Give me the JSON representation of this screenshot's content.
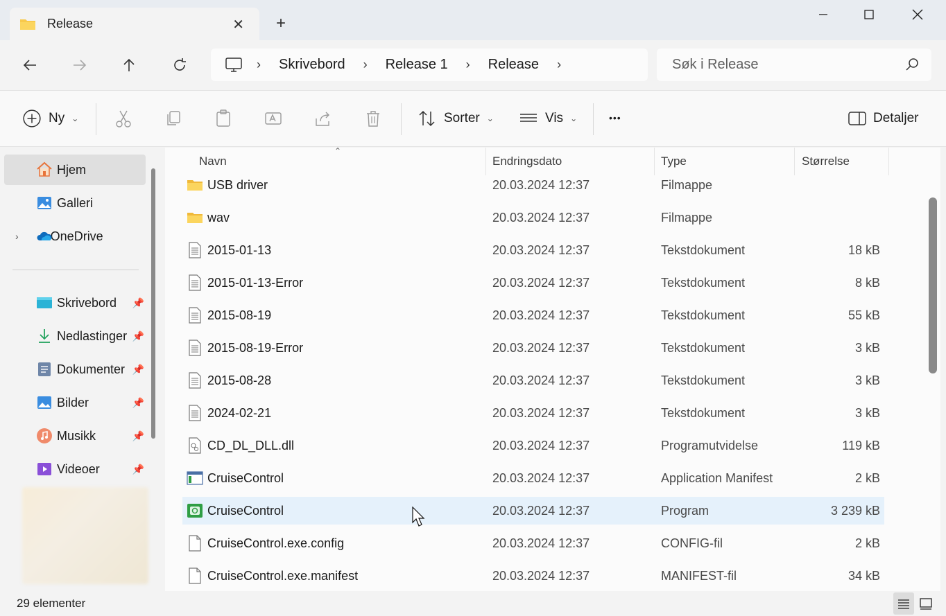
{
  "window": {
    "tab_title": "Release",
    "tab_icon": "folder-icon",
    "new_tab_label": "+",
    "close_tab_label": "✕"
  },
  "address": {
    "crumbs": [
      "Skrivebord",
      "Release 1",
      "Release"
    ],
    "root_icon": "computer-icon"
  },
  "search": {
    "placeholder": "Søk i Release"
  },
  "toolbar": {
    "new_label": "Ny",
    "sort_label": "Sorter",
    "view_label": "Vis",
    "more_label": "•••",
    "details_label": "Detaljer"
  },
  "sidebar": {
    "items": [
      {
        "label": "Hjem",
        "icon": "home-icon"
      },
      {
        "label": "Galleri",
        "icon": "gallery-icon"
      },
      {
        "label": "OneDrive",
        "icon": "onedrive-icon"
      },
      {
        "label": "Skrivebord",
        "icon": "desktop-icon"
      },
      {
        "label": "Nedlastinger",
        "icon": "download-icon"
      },
      {
        "label": "Dokumenter",
        "icon": "document-icon"
      },
      {
        "label": "Bilder",
        "icon": "pictures-icon"
      },
      {
        "label": "Musikk",
        "icon": "music-icon"
      },
      {
        "label": "Videoer",
        "icon": "video-icon"
      }
    ]
  },
  "columns": {
    "name": "Navn",
    "date": "Endringsdato",
    "type": "Type",
    "size": "Størrelse"
  },
  "files": [
    {
      "name": "USB driver",
      "date": "20.03.2024 12:37",
      "type": "Filmappe",
      "size": "",
      "icon": "folder-icon"
    },
    {
      "name": "wav",
      "date": "20.03.2024 12:37",
      "type": "Filmappe",
      "size": "",
      "icon": "folder-icon"
    },
    {
      "name": "2015-01-13",
      "date": "20.03.2024 12:37",
      "type": "Tekstdokument",
      "size": "18 kB",
      "icon": "text-file-icon"
    },
    {
      "name": "2015-01-13-Error",
      "date": "20.03.2024 12:37",
      "type": "Tekstdokument",
      "size": "8 kB",
      "icon": "text-file-icon"
    },
    {
      "name": "2015-08-19",
      "date": "20.03.2024 12:37",
      "type": "Tekstdokument",
      "size": "55 kB",
      "icon": "text-file-icon"
    },
    {
      "name": "2015-08-19-Error",
      "date": "20.03.2024 12:37",
      "type": "Tekstdokument",
      "size": "3 kB",
      "icon": "text-file-icon"
    },
    {
      "name": "2015-08-28",
      "date": "20.03.2024 12:37",
      "type": "Tekstdokument",
      "size": "3 kB",
      "icon": "text-file-icon"
    },
    {
      "name": "2024-02-21",
      "date": "20.03.2024 12:37",
      "type": "Tekstdokument",
      "size": "3 kB",
      "icon": "text-file-icon"
    },
    {
      "name": "CD_DL_DLL.dll",
      "date": "20.03.2024 12:37",
      "type": "Programutvidelse",
      "size": "119 kB",
      "icon": "dll-file-icon"
    },
    {
      "name": "CruiseControl",
      "date": "20.03.2024 12:37",
      "type": "Application Manifest",
      "size": "2 kB",
      "icon": "manifest-file-icon"
    },
    {
      "name": "CruiseControl",
      "date": "20.03.2024 12:37",
      "type": "Program",
      "size": "3 239 kB",
      "icon": "program-icon"
    },
    {
      "name": "CruiseControl.exe.config",
      "date": "20.03.2024 12:37",
      "type": "CONFIG-fil",
      "size": "2 kB",
      "icon": "blank-file-icon"
    },
    {
      "name": "CruiseControl.exe.manifest",
      "date": "20.03.2024 12:37",
      "type": "MANIFEST-fil",
      "size": "34 kB",
      "icon": "blank-file-icon"
    }
  ],
  "status": {
    "item_count": "29 elementer"
  },
  "colors": {
    "selected_row": "#e5f1fb",
    "folder": "#f8c94b",
    "accent": "#0067c0"
  }
}
